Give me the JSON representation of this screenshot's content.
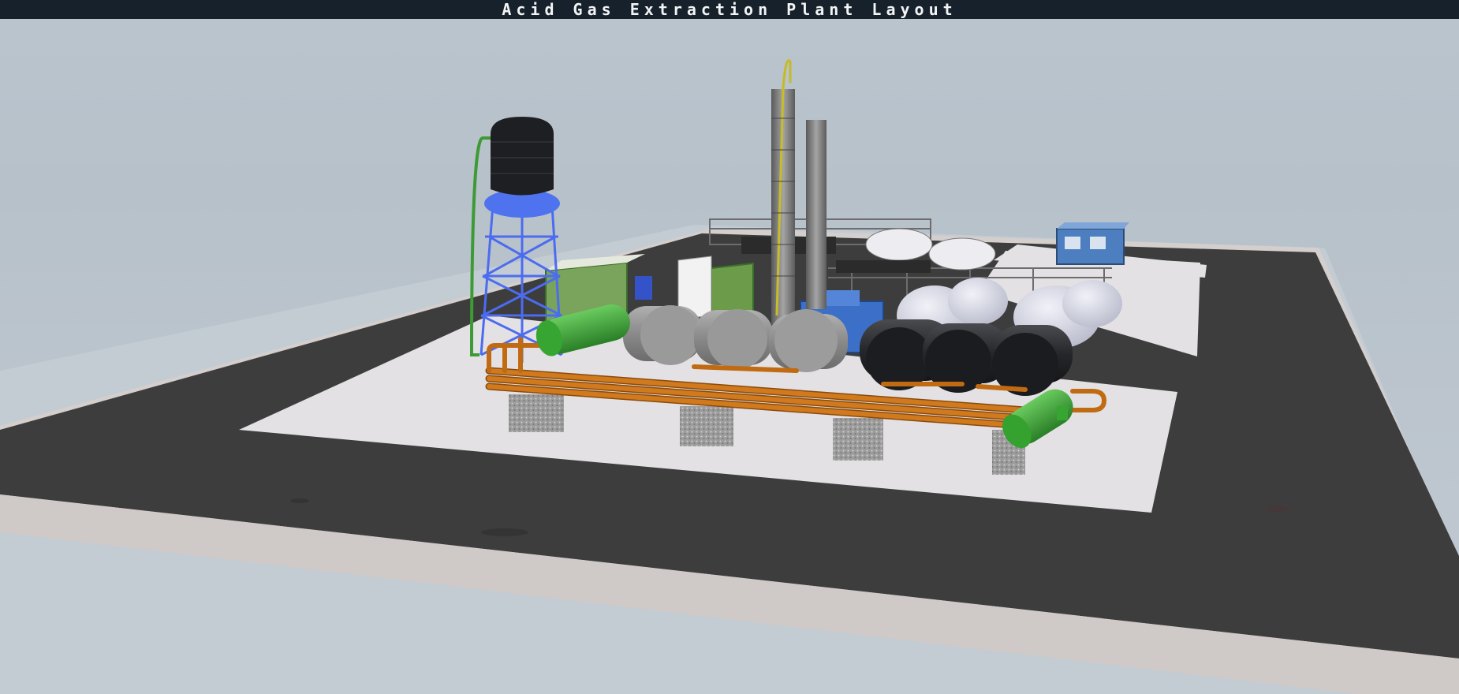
{
  "window": {
    "title": "Acid Gas Extraction Plant Layout"
  },
  "scene": {
    "description_colors": {
      "sky": "#b9c3cc",
      "ground_far": "#c9d0d7",
      "curb": "#d6d2d0",
      "asphalt": "#3e3e3e",
      "concrete_pad": "#e4e2e4",
      "pipe_orange": "#c06a12",
      "vessel_green": "#3ea63a",
      "water_tower_frame": "#4c6cf0",
      "water_tank_black": "#1b1d20",
      "drum_grey": "#8e8e8e",
      "drum_black": "#232427",
      "sphere_white": "#d9dae6",
      "blue_building": "#4d7fc0",
      "column_grey": "#7f7f7f"
    }
  }
}
